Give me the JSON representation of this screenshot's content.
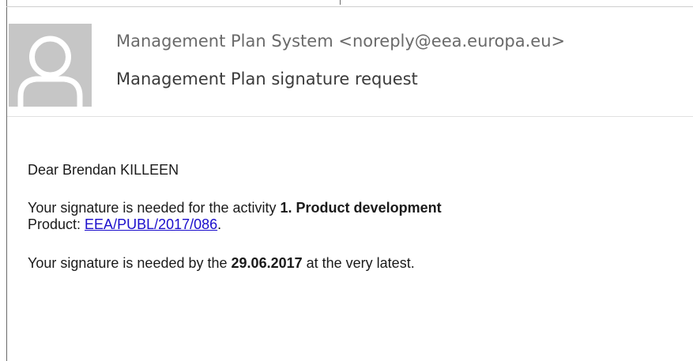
{
  "email": {
    "sender": "Management Plan System <noreply@eea.europa.eu>",
    "subject": "Management Plan signature request",
    "greeting": "Dear Brendan KILLEEN",
    "activity_prefix": "Your signature is needed for the activity ",
    "activity_name": "1. Product development",
    "product_label": "Product: ",
    "product_link": "EEA/PUBL/2017/086",
    "product_suffix": ".",
    "deadline_prefix": "Your signature is needed by the ",
    "deadline_date": "29.06.2017",
    "deadline_suffix": " at the very latest."
  },
  "colors": {
    "avatar_bg": "#c6c6c6",
    "avatar_fg": "#ffffff",
    "link": "#1a0dcc",
    "sender_text": "#6a6a6a"
  },
  "icons": {
    "avatar": "person-silhouette-icon"
  }
}
